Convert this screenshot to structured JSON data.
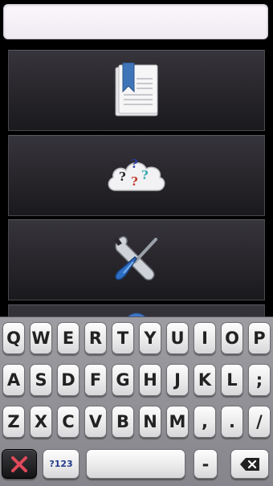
{
  "search": {
    "value": "",
    "placeholder": ""
  },
  "menu": {
    "tiles": [
      {
        "icon": "bookmark-book-icon"
      },
      {
        "icon": "question-cloud-icon"
      },
      {
        "icon": "wrench-screwdriver-icon"
      },
      {
        "icon": "globe-icon"
      }
    ]
  },
  "keyboard": {
    "row1": [
      "Q",
      "W",
      "E",
      "R",
      "T",
      "Y",
      "U",
      "I",
      "O",
      "P"
    ],
    "row2": [
      "A",
      "S",
      "D",
      "F",
      "G",
      "H",
      "J",
      "K",
      "L",
      ";"
    ],
    "row3": [
      "Z",
      "X",
      "C",
      "V",
      "B",
      "N",
      "M",
      ",",
      ".",
      "/"
    ],
    "row4": {
      "symbols_label": "?123",
      "dash_label": "-"
    }
  },
  "colors": {
    "q_blue": "#2a3aa0",
    "q_red": "#c03a2a",
    "q_teal": "#33a8b0"
  }
}
